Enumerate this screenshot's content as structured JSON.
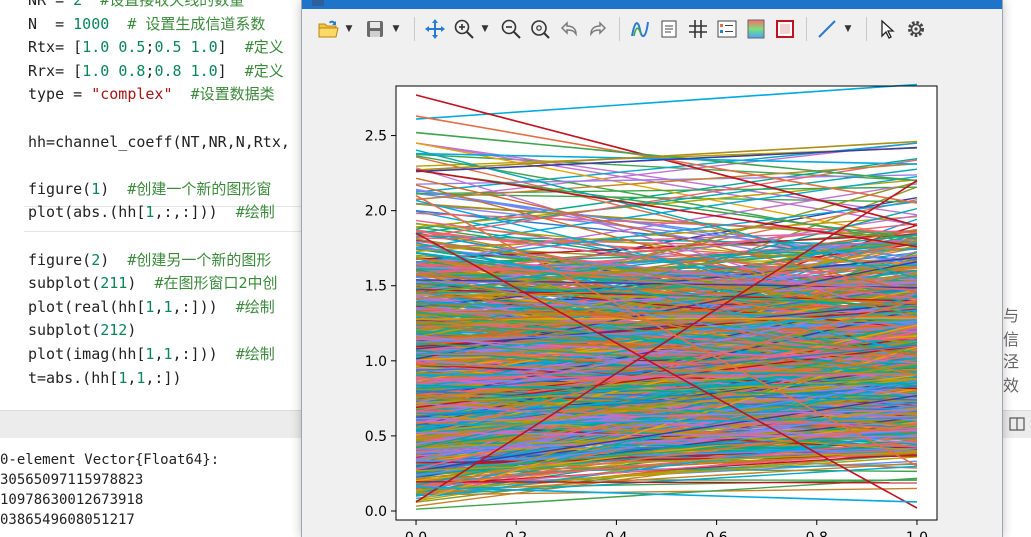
{
  "editor": {
    "lines": [
      {
        "text": "NR = 2  #设置接收天线的数量"
      },
      {
        "text": "N  = 1000  # 设置生成信道系数"
      },
      {
        "text": "Rtx= [1.0 0.5;0.5 1.0]  #定义"
      },
      {
        "text": "Rrx= [1.0 0.8;0.8 1.0]  #定义"
      },
      {
        "text": "type = \"complex\"  #设置数据类"
      },
      {
        "text": ""
      },
      {
        "text": "hh=channel_coeff(NT,NR,N,Rtx,"
      },
      {
        "text": ""
      },
      {
        "text": "figure(1)  #创建一个新的图形窗"
      },
      {
        "text": "plot(abs.(hh[1,:,:]))  #绘制"
      },
      {
        "text": ""
      },
      {
        "text": "figure(2)  #创建另一个新的图形"
      },
      {
        "text": "subplot(211)  #在图形窗口2中创"
      },
      {
        "text": "plot(real(hh[1,1,:]))  #绘制"
      },
      {
        "text": "subplot(212)"
      },
      {
        "text": "plot(imag(hh[1,1,:]))  #绘制"
      },
      {
        "text": "t=abs.(hh[1,1,:])"
      }
    ],
    "right_clip_1": "与信",
    "right_clip_2": "泾效"
  },
  "console": {
    "lines": [
      "0-element Vector{Float64}:",
      "30565097115978823",
      "10978630012673918",
      "0386549608051217"
    ]
  },
  "figure_window": {
    "toolbar": [
      {
        "name": "open-icon"
      },
      {
        "name": "save-icon"
      },
      {
        "name": "pan-icon"
      },
      {
        "name": "zoom-in-icon"
      },
      {
        "name": "zoom-out-icon"
      },
      {
        "name": "zoom-fit-icon"
      },
      {
        "name": "undo-icon"
      },
      {
        "name": "redo-icon"
      },
      {
        "name": "curve-icon"
      },
      {
        "name": "text-icon"
      },
      {
        "name": "grid-icon"
      },
      {
        "name": "legend-icon"
      },
      {
        "name": "colormap-icon"
      },
      {
        "name": "box-icon"
      },
      {
        "name": "line-tool-icon"
      },
      {
        "name": "select-icon"
      },
      {
        "name": "settings-icon"
      }
    ]
  },
  "chart_data": {
    "type": "line",
    "title": "",
    "xlabel": "",
    "ylabel": "",
    "xlim": [
      -0.04,
      1.04
    ],
    "ylim": [
      -0.06,
      2.83
    ],
    "xticks": [
      "0.0",
      "0.2",
      "0.4",
      "0.6",
      "0.8",
      "1.0"
    ],
    "yticks": [
      "0.0",
      "0.5",
      "1.0",
      "1.5",
      "2.0",
      "2.5"
    ],
    "grid": false,
    "legend": "none",
    "palette": [
      "#00a9e0",
      "#e26f46",
      "#3da44d",
      "#c271d2",
      "#ac8e18",
      "#00aaae",
      "#ed5e93",
      "#c68125",
      "#00a98d",
      "#8e971e",
      "#00a9cd",
      "#9b7fe9",
      "#618df6",
      "#f05f73",
      "#d06c22",
      "#b6a000"
    ],
    "series_count": 1000,
    "line_endpoints_x": [
      0.0,
      1.0
    ],
    "notable_lines": [
      {
        "y": [
          2.61,
          2.84
        ],
        "color": "#00a9e0"
      },
      {
        "y": [
          2.77,
          1.9
        ],
        "color": "#c1121f"
      },
      {
        "y": [
          2.63,
          2.05
        ],
        "color": "#e26f46"
      },
      {
        "y": [
          2.52,
          2.2
        ],
        "color": "#3da44d"
      },
      {
        "y": [
          2.38,
          2.31
        ],
        "color": "#00a9e0"
      },
      {
        "y": [
          2.27,
          2.46
        ],
        "color": "#ac8e18"
      },
      {
        "y": [
          2.26,
          2.42
        ],
        "color": "#3d3d9e"
      },
      {
        "y": [
          2.27,
          1.76
        ],
        "color": "#c1121f"
      },
      {
        "y": [
          0.06,
          2.2
        ],
        "color": "#c1121f"
      },
      {
        "y": [
          1.85,
          0.02
        ],
        "color": "#c1121f"
      },
      {
        "y": [
          0.16,
          0.06
        ],
        "color": "#00a9e0"
      },
      {
        "y": [
          2.1,
          0.3
        ],
        "color": "#e26f46"
      }
    ]
  }
}
